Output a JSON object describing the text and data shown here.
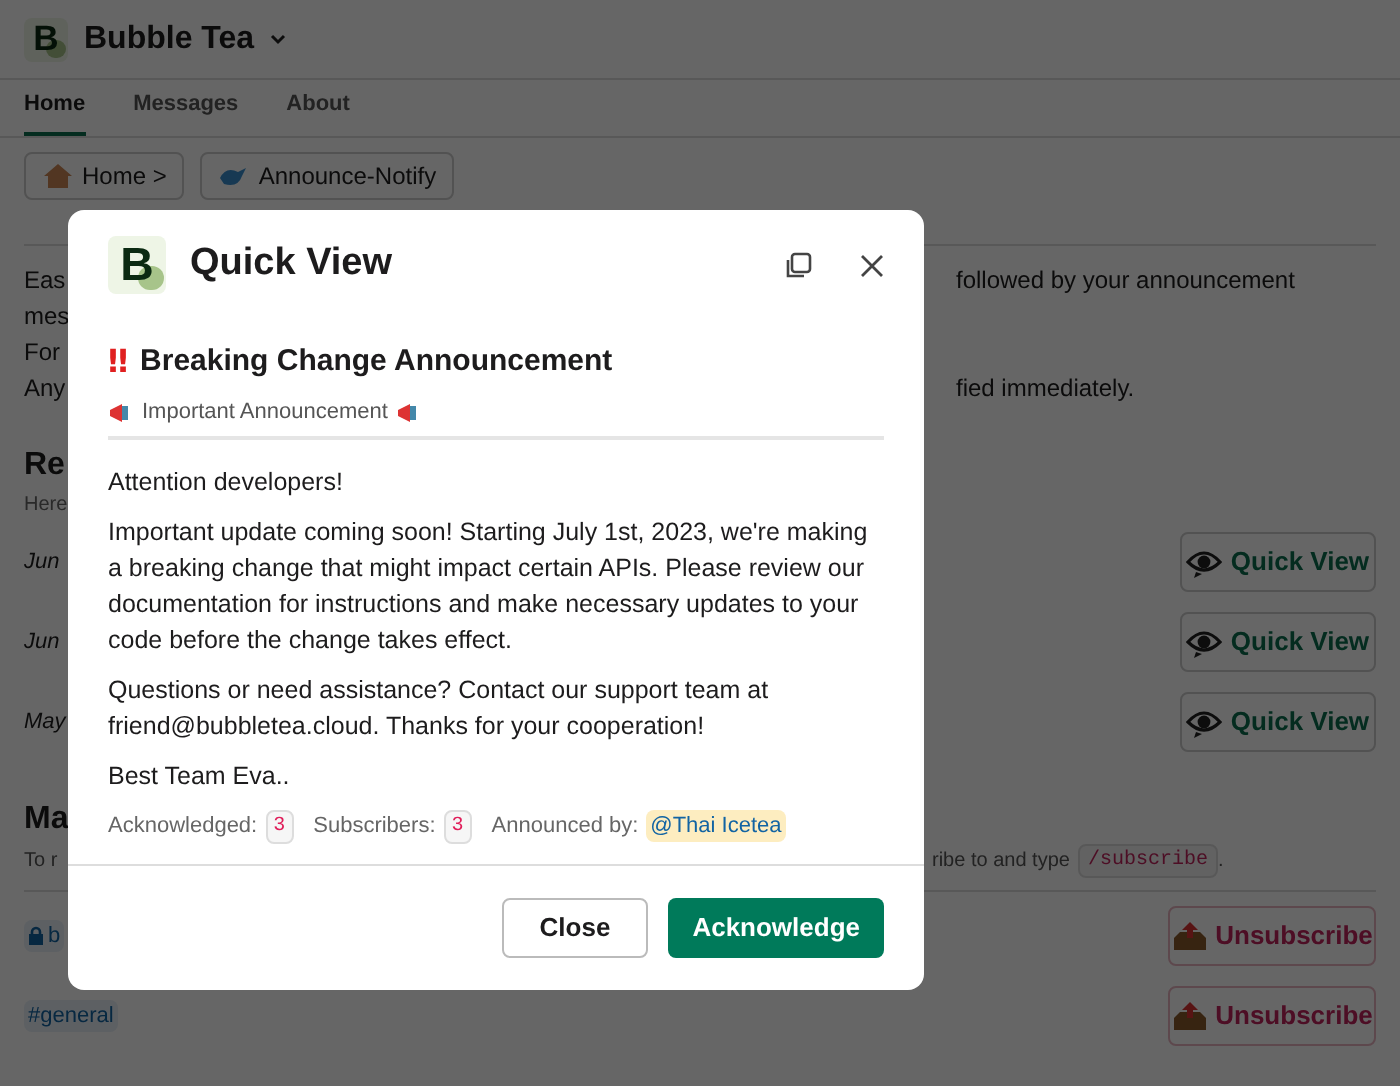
{
  "app": {
    "name": "Bubble Tea",
    "logo_letter": "B"
  },
  "tabs": [
    {
      "label": "Home",
      "selected": true
    },
    {
      "label": "Messages",
      "selected": false
    },
    {
      "label": "About",
      "selected": false
    }
  ],
  "breadcrumbs": [
    {
      "label": "Home >",
      "kind": "home"
    },
    {
      "label": "Announce-Notify",
      "kind": "bird"
    }
  ],
  "intro_lines": [
    {
      "left": "Eas",
      "right": "followed by your announcement"
    },
    {
      "left": "mes"
    },
    {
      "left": "For"
    },
    {
      "left": "Any",
      "right": "fied immediately."
    }
  ],
  "recent": {
    "heading": "Re",
    "hint": "Here",
    "rows": [
      {
        "date": "Jun",
        "button": "Quick View"
      },
      {
        "date": "Jun",
        "button": "Quick View"
      },
      {
        "date": "May",
        "button": "Quick View"
      }
    ]
  },
  "manage": {
    "heading": "Ma",
    "hint_left": "To r",
    "hint_right": "ribe to and type",
    "command": "/subscribe",
    "hint_end": ".",
    "channels": [
      {
        "label": "b",
        "private": true,
        "button": "Unsubscribe"
      },
      {
        "label": "#general",
        "private": false,
        "button": "Unsubscribe"
      }
    ]
  },
  "modal": {
    "logo_letter": "B",
    "title": "Quick View",
    "heading_mark": "‼",
    "heading": "Breaking Change Announcement",
    "subtitle": "Important Announcement",
    "paragraphs": [
      "Attention developers!",
      "Important update coming soon! Starting July 1st, 2023, we're making a breaking change that might impact certain APIs. Please review our documentation for instructions and make necessary updates to your code before the change takes effect.",
      "Questions or need assistance? Contact our support team at friend@bubbletea.cloud. Thanks for your cooperation!",
      "Best Team Eva.."
    ],
    "stats": [
      {
        "label": "Acknowledged:",
        "value": "3"
      },
      {
        "label": "Subscribers:",
        "value": "3"
      }
    ],
    "announced_label": "Announced by:",
    "announced_by": "@Thai Icetea",
    "buttons": [
      {
        "label": "Close",
        "kind": "secondary"
      },
      {
        "label": "Acknowledge",
        "kind": "primary"
      }
    ]
  }
}
